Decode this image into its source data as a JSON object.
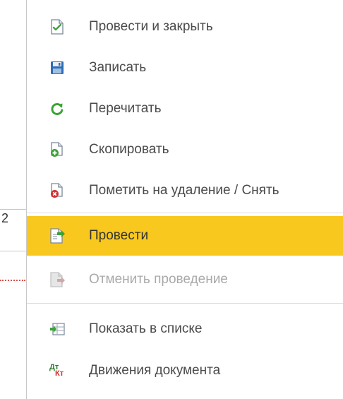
{
  "background": {
    "field_value": "2"
  },
  "menu": {
    "items": [
      {
        "label": "Провести и закрыть",
        "icon": "post-and-close-icon"
      },
      {
        "label": "Записать",
        "icon": "save-icon"
      },
      {
        "label": "Перечитать",
        "icon": "refresh-icon"
      },
      {
        "label": "Скопировать",
        "icon": "copy-icon"
      },
      {
        "label": "Пометить на удаление / Снять",
        "icon": "mark-for-deletion-icon"
      },
      {
        "label": "Провести",
        "icon": "post-icon",
        "highlighted": true
      },
      {
        "label": "Отменить проведение",
        "icon": "unpost-icon",
        "disabled": true
      },
      {
        "label": "Показать в списке",
        "icon": "show-in-list-icon"
      },
      {
        "label": "Движения документа",
        "icon": "document-movements-icon"
      }
    ],
    "dtkt_icon": {
      "top": "Дт",
      "bottom": "Кт"
    }
  },
  "colors": {
    "highlight": "#f8c81e",
    "text": "#4a4a4a",
    "disabled_text": "#a9a9a9",
    "separator": "#dcdcdc"
  }
}
